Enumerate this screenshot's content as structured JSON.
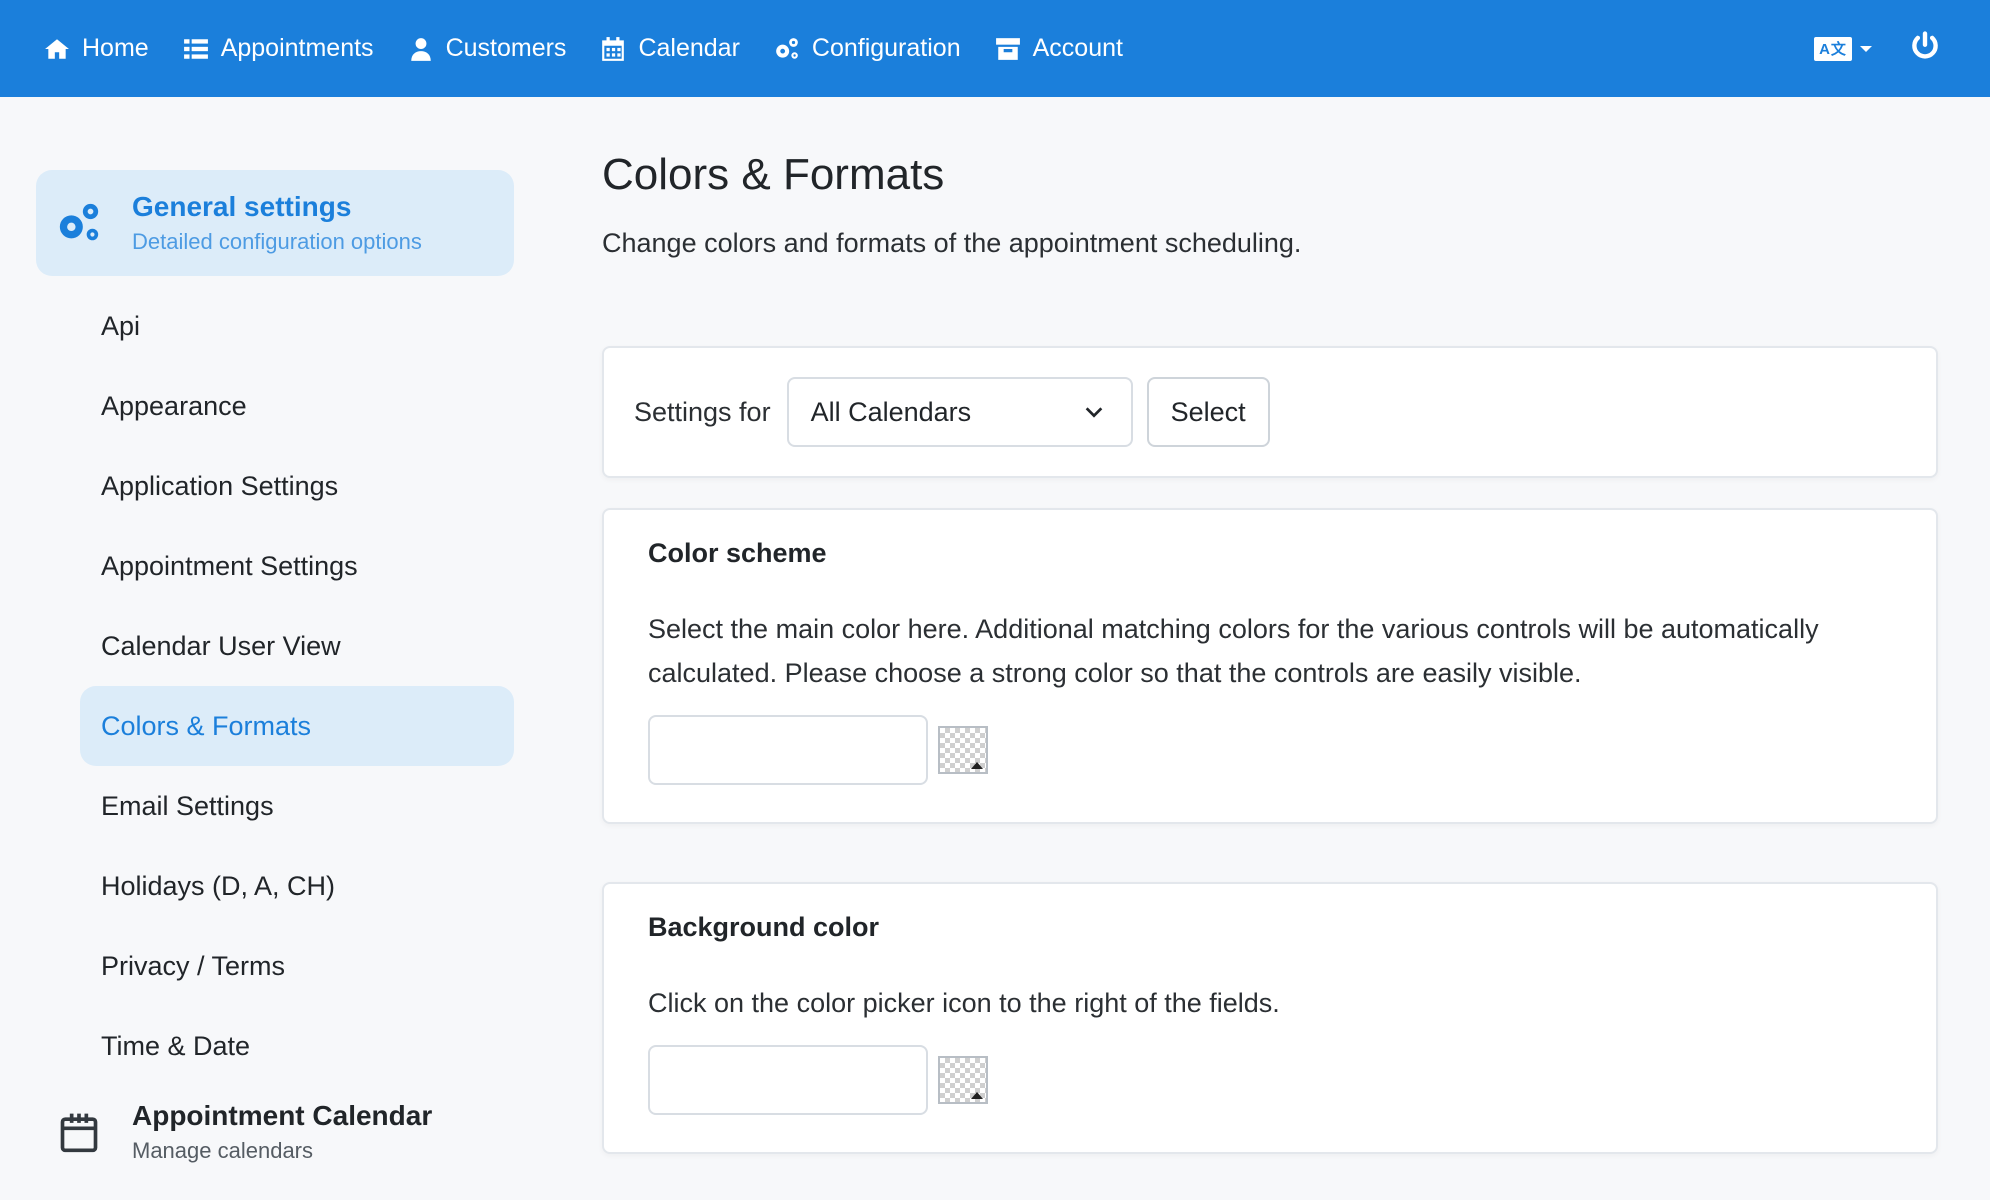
{
  "nav": {
    "items": [
      {
        "label": "Home",
        "icon": "home-icon"
      },
      {
        "label": "Appointments",
        "icon": "list-icon"
      },
      {
        "label": "Customers",
        "icon": "user-icon"
      },
      {
        "label": "Calendar",
        "icon": "calendar-icon"
      },
      {
        "label": "Configuration",
        "icon": "gears-icon"
      },
      {
        "label": "Account",
        "icon": "archive-icon"
      }
    ],
    "language_icon": "translate-icon",
    "power_icon": "power-icon",
    "color": "#1b7fdb"
  },
  "sidebar": {
    "group_general": {
      "title": "General settings",
      "subtitle": "Detailed configuration options"
    },
    "items": [
      "Api",
      "Appearance",
      "Application Settings",
      "Appointment Settings",
      "Calendar User View",
      "Colors & Formats",
      "Email Settings",
      "Holidays (D, A, CH)",
      "Privacy / Terms",
      "Time & Date"
    ],
    "active_item": "Colors & Formats",
    "group_calendar": {
      "title": "Appointment Calendar",
      "subtitle": "Manage calendars"
    }
  },
  "main": {
    "title": "Colors & Formats",
    "subtitle": "Change colors and formats of the appointment scheduling.",
    "settings_for": {
      "label": "Settings for",
      "selected": "All Calendars",
      "button": "Select"
    },
    "color_scheme": {
      "title": "Color scheme",
      "text": "Select the main color here. Additional matching colors for the various controls will be automatically calculated. Please choose a strong color so that the controls are easily visible.",
      "value": ""
    },
    "background_color": {
      "title": "Background color",
      "text": "Click on the color picker icon to the right of the fields.",
      "value": ""
    }
  }
}
